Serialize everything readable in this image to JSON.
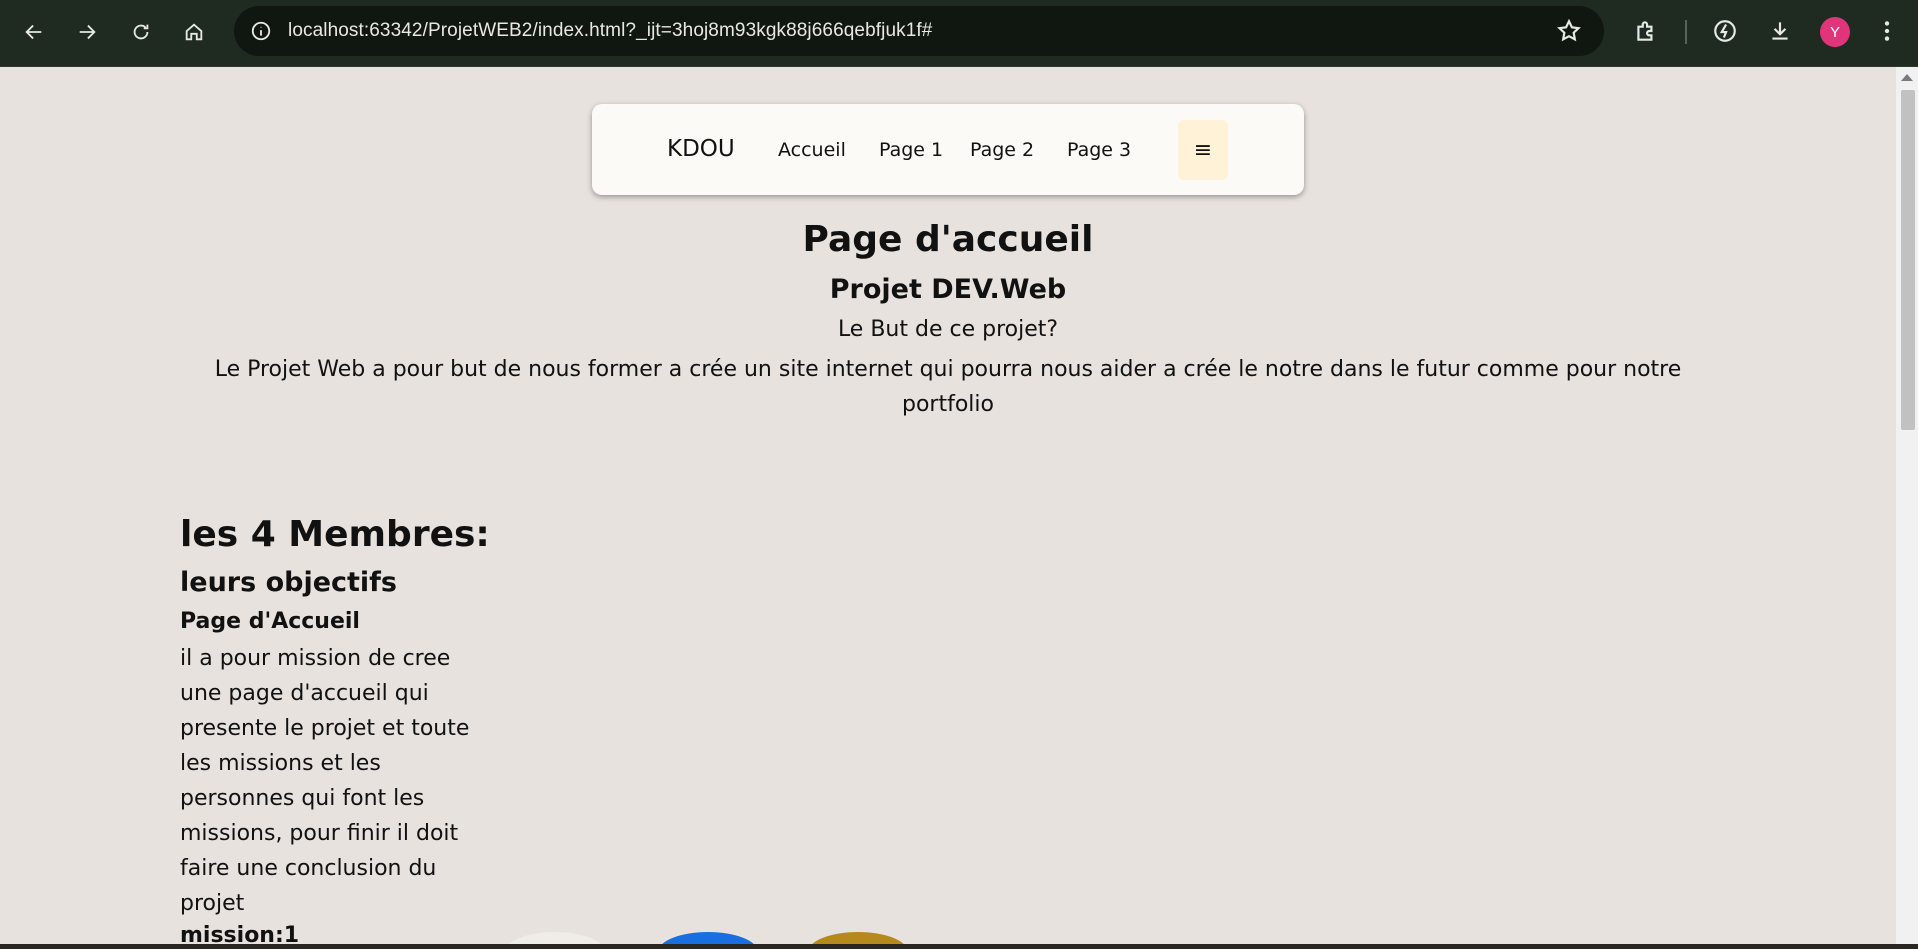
{
  "browser": {
    "url": "localhost:63342/ProjetWEB2/index.html?_ijt=3hoj8m93kgk88j666qebfjuk1f#",
    "profile_initial": "Y",
    "accent_color": "#e0357a",
    "icons": [
      "back-arrow-icon",
      "forward-arrow-icon",
      "reload-icon",
      "home-icon",
      "site-info-icon",
      "bookmark-star-icon",
      "extensions-icon",
      "performance-icon",
      "downloads-icon",
      "more-vert-icon"
    ]
  },
  "navbar": {
    "brand": "KDOU",
    "links": [
      "Accueil",
      "Page 1",
      "Page 2",
      "Page 3"
    ],
    "menu_glyph": "≡"
  },
  "hero": {
    "title": "Page d'accueil",
    "subtitle": "Projet DEV.Web",
    "question": "Le But de ce projet?",
    "description": "Le Projet Web a pour but de nous former a crée un site internet qui pourra nous aider a crée le notre dans le futur comme pour notre portfolio"
  },
  "members": {
    "title": "les 4 Membres:",
    "objectives_title": "leurs objectifs",
    "section_title": "Page d'Accueil",
    "section_text": "il a pour mission de cree une page d'accueil qui presente le projet et toute les missions et les personnes qui font les missions, pour finir il doit faire une conclusion du projet",
    "mission_label": "mission:1"
  }
}
